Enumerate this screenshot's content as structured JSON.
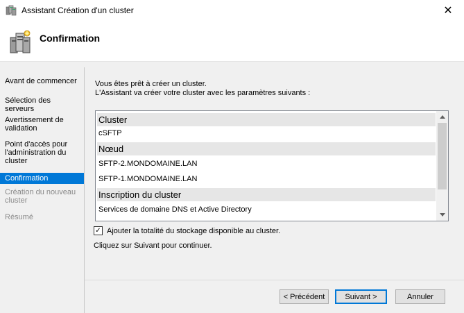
{
  "window": {
    "title": "Assistant Création d'un cluster",
    "close_glyph": "✕"
  },
  "header": {
    "title": "Confirmation",
    "icon": "cluster-servers-icon"
  },
  "nav": {
    "items": [
      {
        "label": "Avant de commencer",
        "state": "normal"
      },
      {
        "label": "Sélection des serveurs",
        "state": "normal"
      },
      {
        "label": "Avertissement de validation",
        "state": "normal"
      },
      {
        "label": "Point d'accès pour l'administration du cluster",
        "state": "normal"
      },
      {
        "label": "Confirmation",
        "state": "active"
      },
      {
        "label": "Création du nouveau cluster",
        "state": "disabled"
      },
      {
        "label": "Résumé",
        "state": "disabled"
      }
    ]
  },
  "content": {
    "intro_line1": "Vous êtes prêt à créer un cluster.",
    "intro_line2": "L'Assistant va créer votre cluster avec les paramètres suivants :",
    "summary": {
      "group_cluster": "Cluster",
      "cluster_name": "cSFTP",
      "group_nodes": "Nœud",
      "node1": "SFTP-2.MONDOMAINE.LAN",
      "node2": "SFTP-1.MONDOMAINE.LAN",
      "group_registration": "Inscription du cluster",
      "registration_value": "Services de domaine DNS et Active Directory"
    },
    "checkbox_label": "Ajouter la totalité du stockage disponible au cluster.",
    "checkbox_checked": true,
    "checkbox_glyph": "✓",
    "hint": "Cliquez sur Suivant pour continuer."
  },
  "buttons": {
    "previous": "< Précédent",
    "next": "Suivant >",
    "cancel": "Annuler"
  },
  "colors": {
    "accent": "#0078d7",
    "group_bg": "#e6e6e6",
    "panel_bg": "#f0f0f0"
  }
}
